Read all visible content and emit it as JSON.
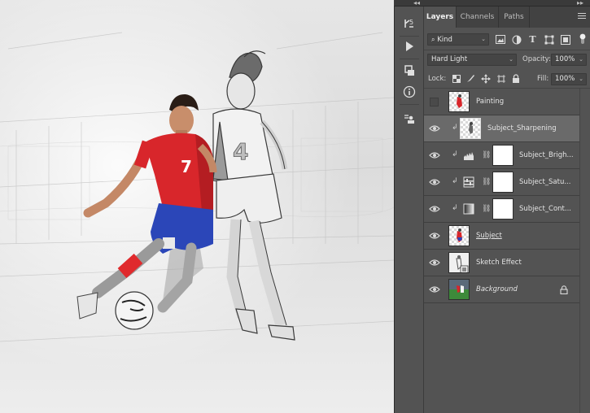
{
  "panel_tabs": [
    {
      "label": "Layers",
      "active": true
    },
    {
      "label": "Channels",
      "active": false
    },
    {
      "label": "Paths",
      "active": false
    }
  ],
  "filter": {
    "kind_label": "Kind"
  },
  "blend": {
    "mode": "Hard Light",
    "opacity_label": "Opacity:",
    "opacity_value": "100%"
  },
  "lock": {
    "label": "Lock:",
    "fill_label": "Fill:",
    "fill_value": "100%"
  },
  "layers": [
    {
      "name": "Painting",
      "visible": false,
      "clipped": false,
      "style": "normal",
      "type": "pixel"
    },
    {
      "name": "Subject_Sharpening",
      "visible": true,
      "clipped": true,
      "style": "normal",
      "type": "pixel",
      "selected": true
    },
    {
      "name": "Subject_Brigh...",
      "visible": true,
      "clipped": true,
      "style": "normal",
      "type": "adjustment",
      "icon": "levels-icon"
    },
    {
      "name": "Subject_Satu...",
      "visible": true,
      "clipped": true,
      "style": "normal",
      "type": "adjustment",
      "icon": "hue-saturation-icon"
    },
    {
      "name": "Subject_Cont...",
      "visible": true,
      "clipped": true,
      "style": "normal",
      "type": "adjustment",
      "icon": "gradient-map-icon"
    },
    {
      "name": "Subject",
      "visible": true,
      "clipped": false,
      "style": "underline",
      "type": "pixel"
    },
    {
      "name": "Sketch Effect",
      "visible": true,
      "clipped": false,
      "style": "normal",
      "type": "smart"
    },
    {
      "name": "Background",
      "visible": true,
      "clipped": false,
      "style": "italic",
      "type": "background",
      "locked": true
    }
  ],
  "colors": {
    "panel": "#535353",
    "tabbar": "#424242",
    "selected_row": "#6a6a6a",
    "jersey_red": "#d8262b",
    "shorts_blue": "#2b46b8"
  }
}
